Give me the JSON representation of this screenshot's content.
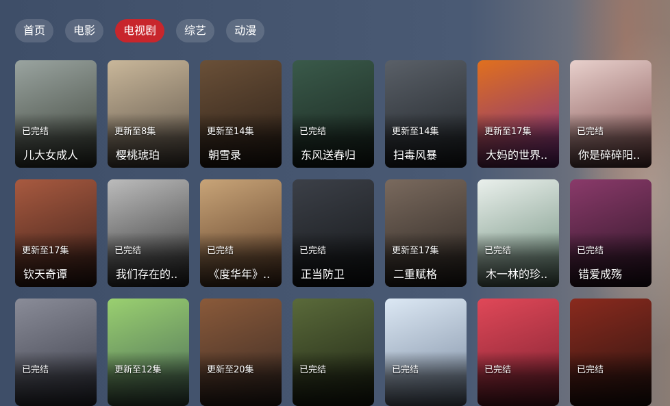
{
  "tabs": [
    {
      "label": "首页",
      "active": false
    },
    {
      "label": "电影",
      "active": false
    },
    {
      "label": "电视剧",
      "active": true
    },
    {
      "label": "综艺",
      "active": false
    },
    {
      "label": "动漫",
      "active": false
    }
  ],
  "accent_color": "#c8262c",
  "items": [
    {
      "title": "儿大女成人",
      "status": "已完结",
      "colors": [
        "#9aa4a0",
        "#3a4036"
      ]
    },
    {
      "title": "樱桃琥珀",
      "status": "更新至8集",
      "colors": [
        "#c9b79a",
        "#5a5046"
      ]
    },
    {
      "title": "朝雪录",
      "status": "更新至14集",
      "colors": [
        "#6a5038",
        "#2a1e16"
      ]
    },
    {
      "title": "东风送春归",
      "status": "已完结",
      "colors": [
        "#3a5a4a",
        "#18241e"
      ]
    },
    {
      "title": "扫毒风暴",
      "status": "更新至14集",
      "colors": [
        "#5a6068",
        "#1e2226"
      ]
    },
    {
      "title": "大妈的世界..",
      "status": "更新至17集",
      "colors": [
        "#e0701e",
        "#7a2c8a"
      ]
    },
    {
      "title": "你是碎碎阳..",
      "status": "已完结",
      "colors": [
        "#e8d0cc",
        "#7a4848"
      ]
    },
    {
      "title": "钦天奇谭",
      "status": "更新至17集",
      "colors": [
        "#a85a40",
        "#3a1e18"
      ]
    },
    {
      "title": "我们存在的..",
      "status": "已完结",
      "colors": [
        "#bcbcbc",
        "#303030"
      ]
    },
    {
      "title": "《度华年》..",
      "status": "已完结",
      "colors": [
        "#c8a478",
        "#5a3a24"
      ]
    },
    {
      "title": "正当防卫",
      "status": "已完结",
      "colors": [
        "#3c4048",
        "#141618"
      ]
    },
    {
      "title": "二重赋格",
      "status": "更新至17集",
      "colors": [
        "#7a6a5e",
        "#2a2420"
      ]
    },
    {
      "title": "木一林的珍..",
      "status": "已完结",
      "colors": [
        "#eaf0ec",
        "#6a8a78"
      ]
    },
    {
      "title": "错爱成殇",
      "status": "已完结",
      "colors": [
        "#8a3a6a",
        "#2a1424"
      ]
    },
    {
      "title": "",
      "status": "已完结",
      "colors": [
        "#8a8c98",
        "#3a3c48"
      ]
    },
    {
      "title": "",
      "status": "更新至12集",
      "colors": [
        "#9ad070",
        "#4a6a58"
      ]
    },
    {
      "title": "",
      "status": "更新至20集",
      "colors": [
        "#8a5a3a",
        "#3a2a24"
      ]
    },
    {
      "title": "",
      "status": "已完结",
      "colors": [
        "#5a6a3a",
        "#1e2414"
      ]
    },
    {
      "title": "",
      "status": "已完结",
      "colors": [
        "#dce8f4",
        "#7a8aa0"
      ]
    },
    {
      "title": "",
      "status": "已完结",
      "colors": [
        "#e04858",
        "#7a2030"
      ]
    },
    {
      "title": "",
      "status": "已完结",
      "colors": [
        "#8a2a1e",
        "#2a1410"
      ]
    }
  ]
}
